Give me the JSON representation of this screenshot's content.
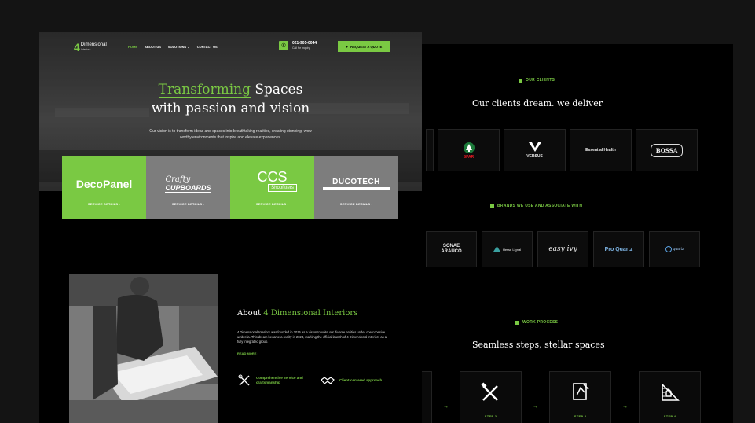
{
  "nav": {
    "brand_num": "4",
    "brand_name": "Dimensional",
    "brand_sub": "Interiors",
    "menu": [
      "HOME",
      "ABOUT US",
      "SOLUTIONS",
      "CONTACT US"
    ],
    "phone_number": "021-905-0044",
    "phone_caption": "Call for Inquiry",
    "quote_label": "REQUEST A QUOTE"
  },
  "hero": {
    "title_highlight": "Transforming",
    "title_rest": " Spaces",
    "title_line2": "with passion and vision",
    "tagline": "Our vision is to transform ideas and spaces into breathtaking realities, creating stunning, wow worthy environments that inspire and elevate experiences."
  },
  "services": [
    {
      "logo": "DecoPanel",
      "details": "SERVICE DETAILS"
    },
    {
      "logo_top": "Crafty",
      "logo_bottom": "CUPBOARDS",
      "details": "SERVICE DETAILS"
    },
    {
      "logo_top": "CCS",
      "logo_bottom": "Shopfitters",
      "details": "SERVICE DETAILS"
    },
    {
      "logo": "DUCOTECH",
      "details": "SERVICE DETAILS"
    }
  ],
  "about": {
    "title_prefix": "About ",
    "title_highlight": "4 Dimensional Interiors",
    "body": "4 Dimensional Interiors was founded in 2015 as a vision to unite our diverse entities under one cohesive umbrella. This dream became a reality in 2024, marking the official launch of 4 Dimensional Interiors as a fully integrated group.",
    "read_more": "READ MORE",
    "features": [
      {
        "label": "Comprehensive service and craftsmanship"
      },
      {
        "label": "Client-centered approach"
      }
    ]
  },
  "clients": {
    "eyebrow": "OUR CLIENTS",
    "heading": "Our clients dream, we deliver",
    "logos": [
      "SPAR",
      "VERSUS",
      "Essential Health",
      "BOSSA"
    ]
  },
  "brands": {
    "eyebrow": "BRANDS WE USE AND ASSOCIATE WITH",
    "logos": [
      "SONAE ARAUCO",
      "Hesse Lignal",
      "easy ivy",
      "Pro Quartz",
      "quartz"
    ]
  },
  "process": {
    "eyebrow": "WORK PROCESS",
    "heading": "Seamless steps, stellar spaces",
    "steps": [
      "STEP 2",
      "STEP 3",
      "STEP 4"
    ]
  },
  "colors": {
    "accent": "#7ac943",
    "grey_card": "#7d7d7d",
    "background": "#000000"
  }
}
